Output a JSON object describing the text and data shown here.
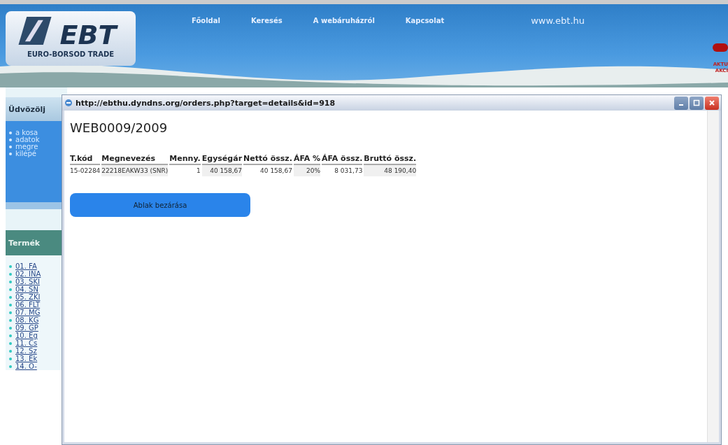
{
  "site": {
    "logo": "EBT",
    "logo_sub": "EURO-BORSOD TRADE",
    "nav": [
      {
        "label": "Főoldal"
      },
      {
        "label": "Keresés"
      },
      {
        "label": "A webáruházról"
      },
      {
        "label": "Kapcsolat"
      }
    ],
    "url": "www.ebt.hu",
    "promo": [
      "AKTU",
      "AKCI"
    ]
  },
  "sidebar": {
    "welcome_title": "Üdvözölj",
    "welcome_links": [
      "a kosa",
      "adatok",
      "megre",
      "kilépé"
    ],
    "products_title": "Termék",
    "products": [
      "01. FA",
      "02. INA",
      "03. SKI",
      "04. SN",
      "05. ZKI",
      "06. FLT",
      "07. MG",
      "08. KG",
      "09. GP",
      "10. Eg",
      "11. Cs",
      "12. Sz",
      "13. Ek",
      "14. O-"
    ]
  },
  "popup": {
    "title": "http://ebthu.dyndns.org/orders.php?target=details&id=918",
    "heading": "WEB0009/2009",
    "table": {
      "columns": [
        {
          "label": "T.kód",
          "kind": "text"
        },
        {
          "label": "Megnevezés",
          "kind": "text"
        },
        {
          "label": "Menny.",
          "kind": "number"
        },
        {
          "label": "Egységár",
          "kind": "number"
        },
        {
          "label": "Nettó össz.",
          "kind": "number"
        },
        {
          "label": "ÁFA %",
          "kind": "number"
        },
        {
          "label": "ÁFA össz.",
          "kind": "number"
        },
        {
          "label": "Bruttó össz.",
          "kind": "number"
        }
      ],
      "rows": [
        [
          "15-02284",
          "22218EAKW33 (SNR)",
          "1",
          "40 158,67",
          "40 158,67",
          "20%",
          "8 031,73",
          "48 190,40"
        ]
      ]
    },
    "close_button": "Ablak bezárása"
  }
}
